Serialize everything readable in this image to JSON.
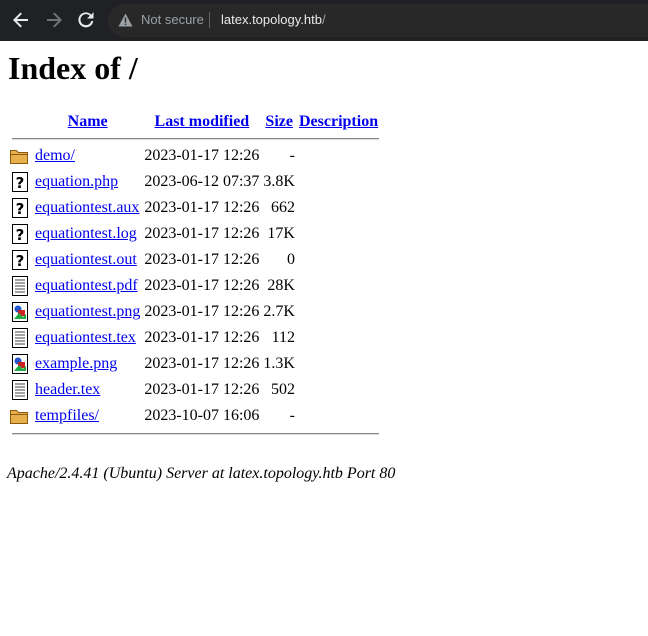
{
  "browser": {
    "security_label": "Not secure",
    "url_host": "latex.topology.htb",
    "url_path": "/"
  },
  "page": {
    "title": "Index of /",
    "columns": {
      "name": "Name",
      "modified": "Last modified",
      "size": "Size",
      "description": "Description"
    },
    "rows": [
      {
        "icon": "folder-icon",
        "name": "demo/",
        "modified": "2023-01-17 12:26",
        "size": "-"
      },
      {
        "icon": "unknown-file-icon",
        "name": "equation.php",
        "modified": "2023-06-12 07:37",
        "size": "3.8K"
      },
      {
        "icon": "unknown-file-icon",
        "name": "equationtest.aux",
        "modified": "2023-01-17 12:26",
        "size": "662"
      },
      {
        "icon": "unknown-file-icon",
        "name": "equationtest.log",
        "modified": "2023-01-17 12:26",
        "size": "17K"
      },
      {
        "icon": "unknown-file-icon",
        "name": "equationtest.out",
        "modified": "2023-01-17 12:26",
        "size": "0"
      },
      {
        "icon": "text-file-icon",
        "name": "equationtest.pdf",
        "modified": "2023-01-17 12:26",
        "size": "28K"
      },
      {
        "icon": "image-file-icon",
        "name": "equationtest.png",
        "modified": "2023-01-17 12:26",
        "size": "2.7K"
      },
      {
        "icon": "text-file-icon",
        "name": "equationtest.tex",
        "modified": "2023-01-17 12:26",
        "size": "112"
      },
      {
        "icon": "image-file-icon",
        "name": "example.png",
        "modified": "2023-01-17 12:26",
        "size": "1.3K"
      },
      {
        "icon": "text-file-icon",
        "name": "header.tex",
        "modified": "2023-01-17 12:26",
        "size": "502"
      },
      {
        "icon": "folder-icon",
        "name": "tempfiles/",
        "modified": "2023-10-07 16:06",
        "size": "-"
      }
    ],
    "footer": "Apache/2.4.41 (Ubuntu) Server at latex.topology.htb Port 80"
  }
}
